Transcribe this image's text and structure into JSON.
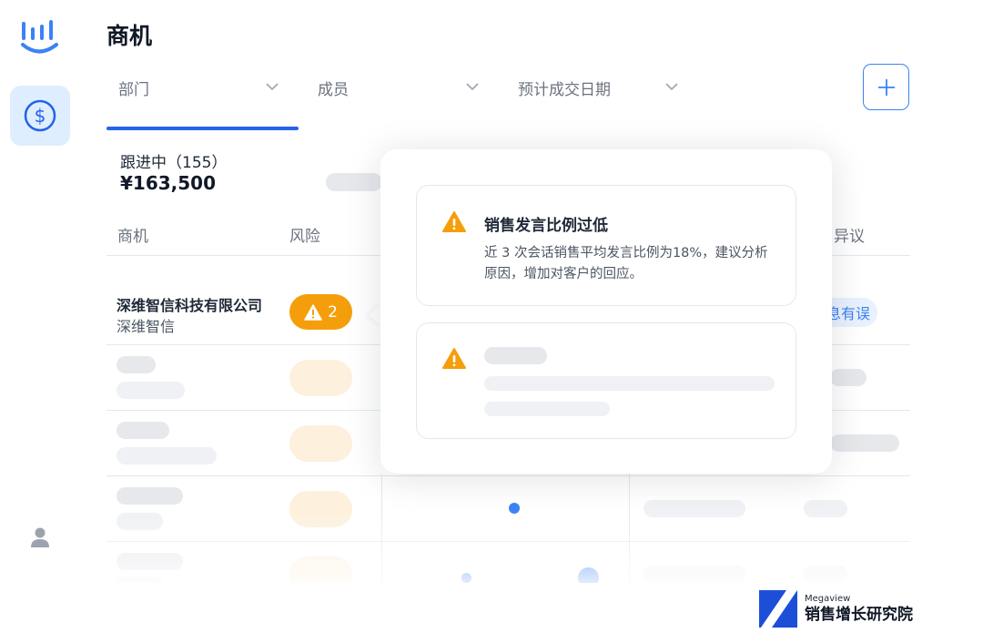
{
  "page_title": "商机",
  "filters": [
    {
      "label": "部门"
    },
    {
      "label": "成员"
    },
    {
      "label": "预计成交日期"
    }
  ],
  "summary": {
    "label": "跟进中（155）",
    "amount": "¥163,500"
  },
  "columns": {
    "deal": "商机",
    "risk": "风险",
    "objection": "异议"
  },
  "row1": {
    "company": "深维智信科技有限公司",
    "company_short": "深维智信",
    "risk_count": "2",
    "tag": "息有误"
  },
  "popover": {
    "warning_title": "销售发言比例过低",
    "warning_desc": "近 3 次会话销售平均发言比例为18%，建议分析原因，增加对客户的回应。"
  },
  "brand": {
    "en": "Megaview",
    "cn": "销售增长研究院"
  },
  "colors": {
    "primary": "#3b82f6",
    "warning": "#f59e0b",
    "nav_active_bg": "#dfeefe"
  },
  "icons": {
    "logo": "bar-chart-logo-icon",
    "nav": "dollar-circle-icon",
    "user": "user-icon",
    "add": "plus-icon",
    "warning": "warning-triangle-icon",
    "dropdown": "chevron-down-icon"
  }
}
